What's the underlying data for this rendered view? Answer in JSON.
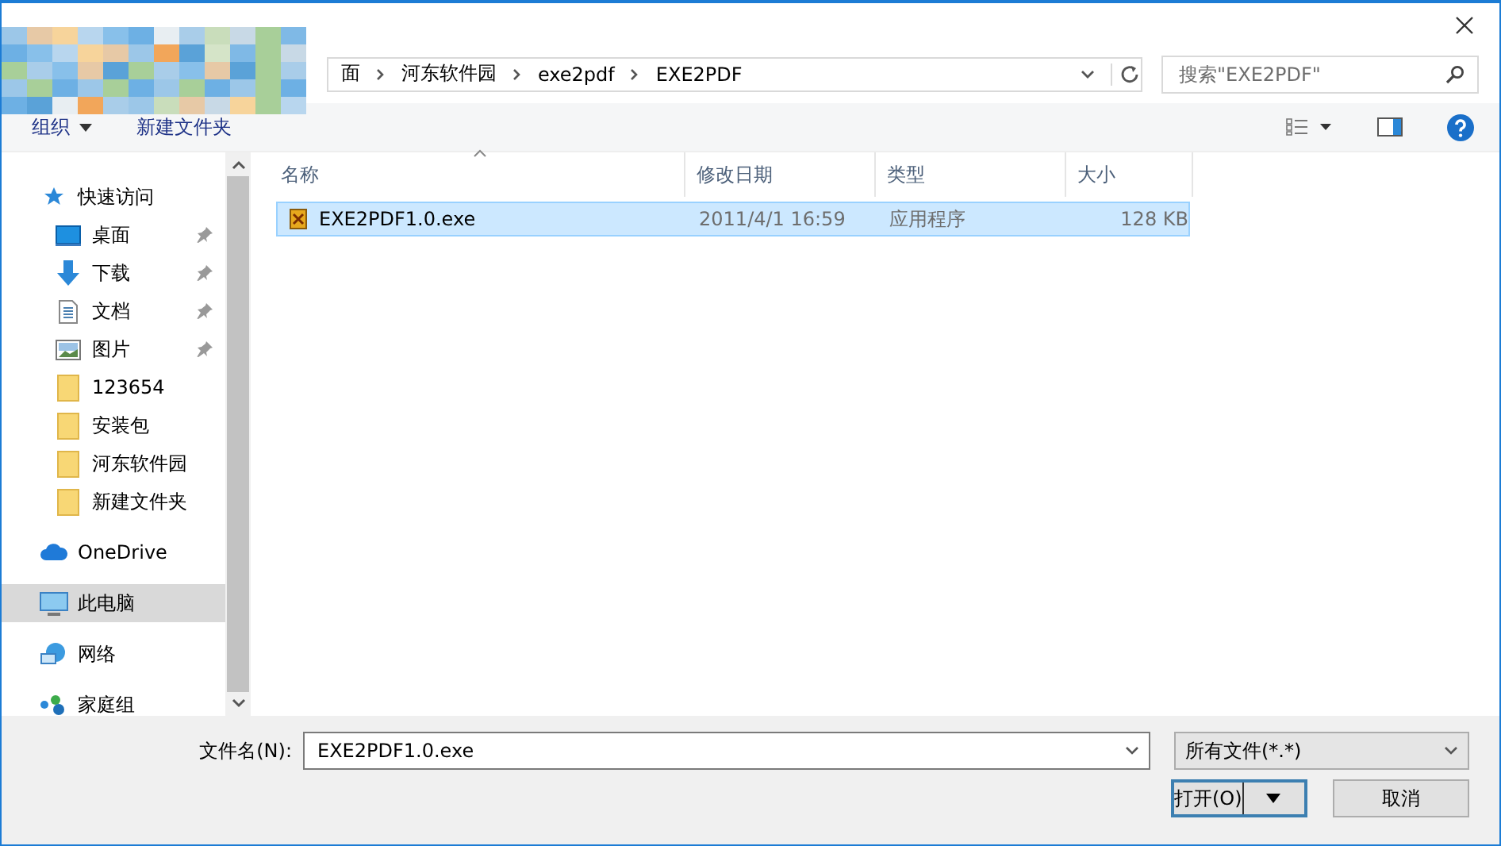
{
  "address_bar": {
    "breadcrumbs": [
      "面",
      "河东软件园",
      "exe2pdf",
      "EXE2PDF"
    ]
  },
  "search": {
    "placeholder": "搜索\"EXE2PDF\""
  },
  "toolbar": {
    "organize": "组织",
    "new_folder": "新建文件夹"
  },
  "sidebar": {
    "items": [
      {
        "label": "快速访问",
        "kind": "star",
        "selected": false,
        "children": [
          {
            "label": "桌面",
            "kind": "desktop",
            "pinned": true,
            "selected": false
          },
          {
            "label": "下载",
            "kind": "download",
            "pinned": true,
            "selected": false
          },
          {
            "label": "文档",
            "kind": "document",
            "pinned": true,
            "selected": false
          },
          {
            "label": "图片",
            "kind": "picture",
            "pinned": true,
            "selected": false
          },
          {
            "label": "123654",
            "kind": "folder",
            "pinned": false,
            "selected": false
          },
          {
            "label": "安装包",
            "kind": "folder",
            "pinned": false,
            "selected": false
          },
          {
            "label": "河东软件园",
            "kind": "folder",
            "pinned": false,
            "selected": false
          },
          {
            "label": "新建文件夹",
            "kind": "folder",
            "pinned": false,
            "selected": false
          }
        ]
      },
      {
        "label": "OneDrive",
        "kind": "cloud",
        "selected": false
      },
      {
        "label": "此电脑",
        "kind": "computer",
        "selected": true
      },
      {
        "label": "网络",
        "kind": "network",
        "selected": false
      },
      {
        "label": "家庭组",
        "kind": "homegroup",
        "selected": false
      }
    ]
  },
  "table": {
    "columns": [
      "名称",
      "修改日期",
      "类型",
      "大小"
    ],
    "rows": [
      {
        "name": "EXE2PDF1.0.exe",
        "modified": "2011/4/1 16:59",
        "type": "应用程序",
        "size": "128 KB",
        "selected": true
      }
    ]
  },
  "footer": {
    "filename_label": "文件名(N):",
    "filename": "EXE2PDF1.0.exe",
    "filter": "所有文件(*.*)",
    "open_button": "打开(O)",
    "cancel_button": "取消"
  }
}
